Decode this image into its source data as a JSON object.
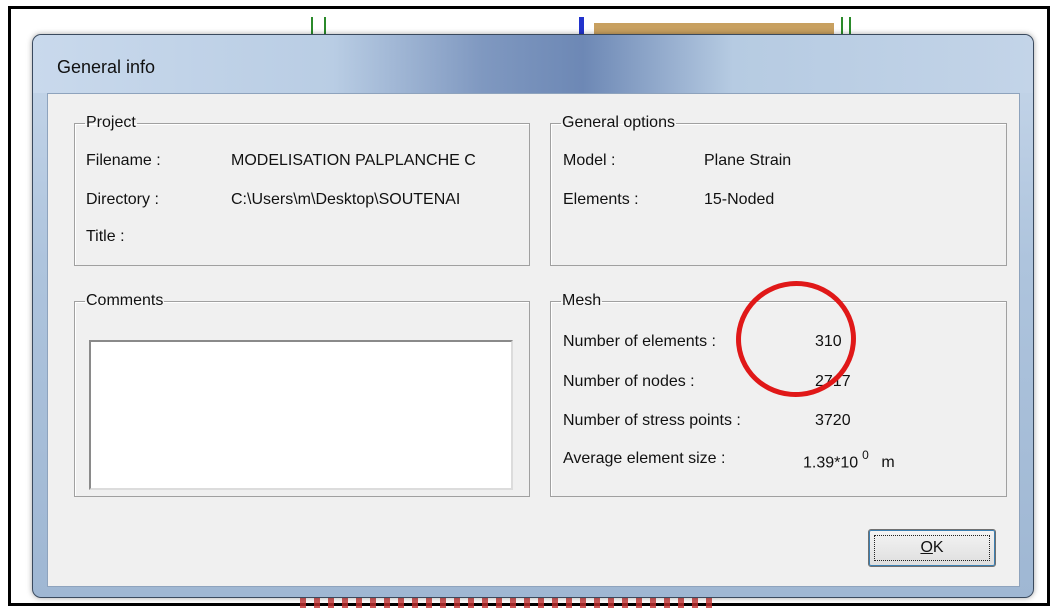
{
  "window": {
    "title": "General info"
  },
  "project": {
    "legend": "Project",
    "filename_label": "Filename :",
    "filename_value": "MODELISATION PALPLANCHE C",
    "directory_label": "Directory :",
    "directory_value": "C:\\Users\\m\\Desktop\\SOUTENAI",
    "title_label": "Title :"
  },
  "general_options": {
    "legend": "General options",
    "model_label": "Model :",
    "model_value": "Plane Strain",
    "elements_label": "Elements :",
    "elements_value": "15-Noded"
  },
  "comments": {
    "legend": "Comments",
    "value": ""
  },
  "mesh": {
    "legend": "Mesh",
    "num_elements_label": "Number of elements :",
    "num_elements_value": "310",
    "num_nodes_label": "Number of nodes :",
    "num_nodes_value": "2717",
    "num_stress_points_label": "Number of stress points :",
    "num_stress_points_value": "3720",
    "avg_size_label": "Average element size :",
    "avg_size_base": "1.39*10",
    "avg_size_exponent": "0",
    "avg_size_unit": "m"
  },
  "buttons": {
    "ok_prefix": "O",
    "ok_rest": "K"
  },
  "colors": {
    "annotation_circle": "#e01818"
  }
}
